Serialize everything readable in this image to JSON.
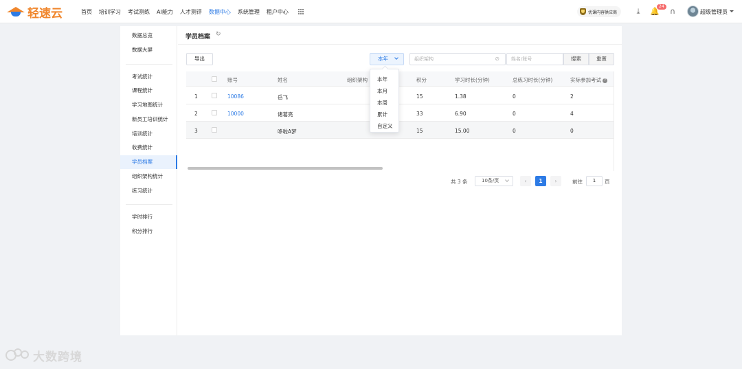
{
  "brand": {
    "name": "轻速云",
    "colors": {
      "orange": "#f0862c",
      "blue": "#2d7be5"
    }
  },
  "nav": {
    "items": [
      "首页",
      "培训学习",
      "考试测练",
      "AI能力",
      "人才测评",
      "数据中心",
      "系统管理",
      "租户中心"
    ],
    "active": "数据中心"
  },
  "header": {
    "promo": "优课内容供应商",
    "notification_count": "24",
    "user": "超级管理员",
    "icons": [
      "apps-icon",
      "download-icon",
      "bell-icon",
      "headset-icon"
    ]
  },
  "sidebar": {
    "group1": [
      "数据总览",
      "数据大屏"
    ],
    "group2": [
      "考试统计",
      "课程统计",
      "学习地图统计",
      "新员工培训统计",
      "培训统计",
      "收费统计",
      "学员档案",
      "组织架构统计",
      "练习统计"
    ],
    "group3": [
      "学时排行",
      "积分排行"
    ],
    "active": "学员档案"
  },
  "page": {
    "title": "学员档案"
  },
  "toolbar": {
    "export": "导出",
    "period": "本年",
    "org_placeholder": "组织架构",
    "name_placeholder": "姓名/账号",
    "search": "搜索",
    "reset": "重置"
  },
  "dropdown": {
    "options": [
      "本年",
      "本月",
      "本周",
      "累计",
      "自定义"
    ]
  },
  "table": {
    "headers": {
      "account": "账号",
      "name": "姓名",
      "org": "组织架构",
      "points": "积分",
      "study": "学习时长(分钟)",
      "practice": "总练习时长(分钟)",
      "exams": "实际参加考试"
    },
    "rows": [
      {
        "index": "1",
        "account": "10086",
        "name": "岳飞",
        "points": "15",
        "study": "1.38",
        "practice": "0",
        "exams": "2"
      },
      {
        "index": "2",
        "account": "10000",
        "name": "诸葛亮",
        "points": "33",
        "study": "6.90",
        "practice": "0",
        "exams": "4"
      },
      {
        "index": "3",
        "account": "",
        "name": "哆啦A梦",
        "points": "15",
        "study": "15.00",
        "practice": "0",
        "exams": "0"
      }
    ]
  },
  "pagination": {
    "total": "共 3 条",
    "page_size": "10条/页",
    "current": "1",
    "goto_label": "前往",
    "goto_value": "1",
    "goto_unit": "页"
  },
  "watermark": "大数跨境"
}
